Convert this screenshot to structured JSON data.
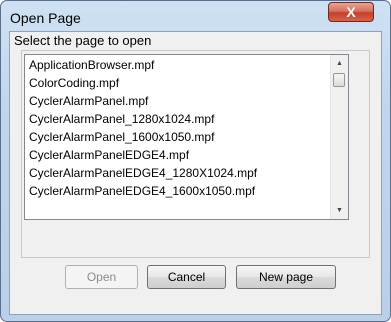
{
  "window": {
    "title": "Open Page",
    "close_label": "X"
  },
  "dialog": {
    "prompt": "Select the page to open",
    "files": [
      "ApplicationBrowser.mpf",
      "ColorCoding.mpf",
      "CyclerAlarmPanel.mpf",
      "CyclerAlarmPanel_1280x1024.mpf",
      "CyclerAlarmPanel_1600x1050.mpf",
      "CyclerAlarmPanelEDGE4.mpf",
      "CyclerAlarmPanelEDGE4_1280X1024.mpf",
      "CyclerAlarmPanelEDGE4_1600x1050.mpf"
    ],
    "scroll_up": "▲",
    "scroll_down": "▼"
  },
  "buttons": {
    "open_label": "Open",
    "cancel_label": "Cancel",
    "new_page_label": "New page"
  }
}
